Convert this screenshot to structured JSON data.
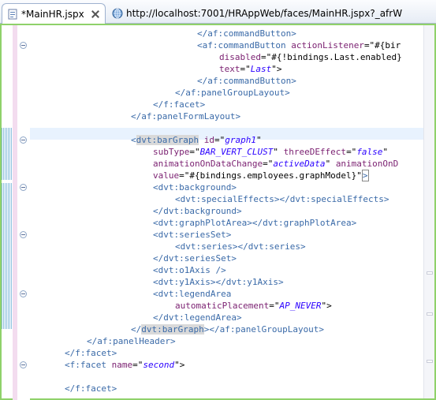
{
  "tabs": [
    {
      "label": "*MainHR.jspx",
      "active": true,
      "icon": "jspx-file-icon"
    },
    {
      "label": "http://localhost:7001/HRAppWeb/faces/MainHR.jspx?_afrW",
      "active": false,
      "icon": "globe-icon"
    }
  ],
  "colors": {
    "tag": "#3a6aa8",
    "attribute": "#7a1f70",
    "string": "#2a00ff",
    "current_line": "#e8f2fe",
    "frame": "#8fd16a"
  },
  "code_lines": [
    {
      "segments": [
        {
          "t": "</af:commandButton>",
          "c": "tag"
        }
      ],
      "fold": false
    },
    {
      "segments": [
        {
          "t": "<af:commandButton ",
          "c": "tag"
        },
        {
          "t": "actionListener",
          "c": "attr"
        },
        {
          "t": "=\"#{bir",
          "c": "plain"
        }
      ],
      "fold": true
    },
    {
      "segments": [
        {
          "t": "disabled",
          "c": "attr"
        },
        {
          "t": "=\"#{!bindings.Last.enabled}",
          "c": "plain"
        }
      ],
      "fold": false
    },
    {
      "segments": [
        {
          "t": "text",
          "c": "attr"
        },
        {
          "t": "=\"",
          "c": "plain"
        },
        {
          "t": "Last",
          "c": "str"
        },
        {
          "t": "\">",
          "c": "plain"
        }
      ],
      "fold": false
    },
    {
      "segments": [
        {
          "t": "</af:commandButton>",
          "c": "tag"
        }
      ],
      "fold": false
    },
    {
      "segments": [
        {
          "t": "</af:panelGroupLayout>",
          "c": "tag"
        }
      ],
      "fold": false
    },
    {
      "segments": [
        {
          "t": "</f:facet>",
          "c": "tag"
        }
      ],
      "fold": false
    },
    {
      "segments": [
        {
          "t": "</af:panelFormLayout>",
          "c": "tag"
        }
      ],
      "fold": false
    },
    {
      "segments": [],
      "fold": false
    },
    {
      "segments": [
        {
          "t": "<",
          "c": "tag"
        },
        {
          "t": "dvt:barGraph",
          "c": "tag",
          "hl": true
        },
        {
          "t": " ",
          "c": "plain"
        },
        {
          "t": "id",
          "c": "attr"
        },
        {
          "t": "=\"",
          "c": "plain"
        },
        {
          "t": "graph1",
          "c": "str"
        },
        {
          "t": "\"",
          "c": "plain"
        }
      ],
      "fold": true
    },
    {
      "segments": [
        {
          "t": "subType",
          "c": "attr"
        },
        {
          "t": "=\"",
          "c": "plain"
        },
        {
          "t": "BAR_VERT_CLUST",
          "c": "str"
        },
        {
          "t": "\" ",
          "c": "plain"
        },
        {
          "t": "threeDEffect",
          "c": "attr"
        },
        {
          "t": "=\"",
          "c": "plain"
        },
        {
          "t": "false",
          "c": "str"
        },
        {
          "t": "\"",
          "c": "plain"
        }
      ],
      "fold": false
    },
    {
      "segments": [
        {
          "t": "animationOnDataChange",
          "c": "attr"
        },
        {
          "t": "=\"",
          "c": "plain"
        },
        {
          "t": "activeData",
          "c": "str"
        },
        {
          "t": "\" ",
          "c": "plain"
        },
        {
          "t": "animationOnD",
          "c": "attr"
        }
      ],
      "fold": false
    },
    {
      "segments": [
        {
          "t": "value",
          "c": "attr"
        },
        {
          "t": "=\"#{bindings.employees.graphModel}\"",
          "c": "plain"
        },
        {
          "t": ">",
          "c": "tag",
          "caret": true
        }
      ],
      "fold": false
    },
    {
      "segments": [
        {
          "t": "<dvt:background>",
          "c": "tag"
        }
      ],
      "fold": true
    },
    {
      "segments": [
        {
          "t": "<dvt:specialEffects></dvt:specialEffects>",
          "c": "tag"
        }
      ],
      "fold": false
    },
    {
      "segments": [
        {
          "t": "</dvt:background>",
          "c": "tag"
        }
      ],
      "fold": false
    },
    {
      "segments": [
        {
          "t": "<dvt:graphPlotArea></dvt:graphPlotArea>",
          "c": "tag"
        }
      ],
      "fold": false
    },
    {
      "segments": [
        {
          "t": "<dvt:seriesSet>",
          "c": "tag"
        }
      ],
      "fold": true
    },
    {
      "segments": [
        {
          "t": "<dvt:series></dvt:series>",
          "c": "tag"
        }
      ],
      "fold": false
    },
    {
      "segments": [
        {
          "t": "</dvt:seriesSet>",
          "c": "tag"
        }
      ],
      "fold": false
    },
    {
      "segments": [
        {
          "t": "<dvt:o1Axis />",
          "c": "tag"
        }
      ],
      "fold": false
    },
    {
      "segments": [
        {
          "t": "<dvt:y1Axis></dvt:y1Axis>",
          "c": "tag"
        }
      ],
      "fold": false
    },
    {
      "segments": [
        {
          "t": "<dvt:legendArea",
          "c": "tag"
        }
      ],
      "fold": true
    },
    {
      "segments": [
        {
          "t": "automaticPlacement",
          "c": "attr"
        },
        {
          "t": "=\"",
          "c": "plain"
        },
        {
          "t": "AP_NEVER",
          "c": "str"
        },
        {
          "t": "\">",
          "c": "plain"
        }
      ],
      "fold": false
    },
    {
      "segments": [
        {
          "t": "</dvt:legendArea>",
          "c": "tag"
        }
      ],
      "fold": false
    },
    {
      "segments": [
        {
          "t": "</",
          "c": "tag"
        },
        {
          "t": "dvt:barGraph",
          "c": "tag",
          "hl": true
        },
        {
          "t": "></af:panelGroupLayout>",
          "c": "tag"
        }
      ],
      "fold": false
    },
    {
      "segments": [
        {
          "t": "</af:panelHeader>",
          "c": "tag"
        }
      ],
      "fold": false
    },
    {
      "segments": [
        {
          "t": "</f:facet>",
          "c": "tag"
        }
      ],
      "fold": false
    },
    {
      "segments": [
        {
          "t": "<f:facet ",
          "c": "tag"
        },
        {
          "t": "name",
          "c": "attr"
        },
        {
          "t": "=\"",
          "c": "plain"
        },
        {
          "t": "second",
          "c": "str"
        },
        {
          "t": "\">",
          "c": "plain"
        }
      ],
      "fold": true
    },
    {
      "segments": [],
      "fold": false
    },
    {
      "segments": [
        {
          "t": "</f:facet>",
          "c": "tag"
        }
      ],
      "fold": false
    }
  ]
}
